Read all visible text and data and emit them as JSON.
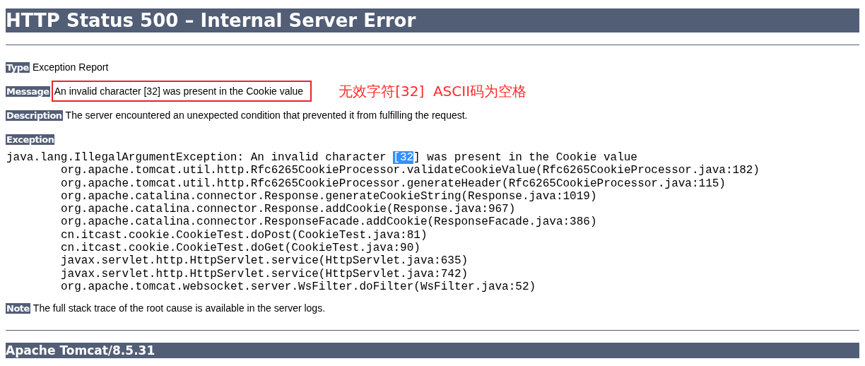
{
  "title": "HTTP Status 500 – Internal Server Error",
  "fields": [
    {
      "label": "Type",
      "value": "Exception Report",
      "boxed": false
    },
    {
      "label": "Message",
      "value": "An invalid character [32] was present in the Cookie value",
      "boxed": true,
      "annotation": "无效字符[32]  ASCII码为空格"
    },
    {
      "label": "Description",
      "value": "The server encountered an unexpected condition that prevented it from fulfilling the request.",
      "boxed": false
    }
  ],
  "exception": {
    "label": "Exception",
    "first_line": [
      {
        "text": "java.lang.IllegalArgumentException: An invalid character ",
        "selected": false
      },
      {
        "text": "[32",
        "selected": true
      },
      {
        "text": "] was present in the Cookie value",
        "selected": false
      }
    ],
    "frames": [
      "org.apache.tomcat.util.http.Rfc6265CookieProcessor.validateCookieValue(Rfc6265CookieProcessor.java:182)",
      "org.apache.tomcat.util.http.Rfc6265CookieProcessor.generateHeader(Rfc6265CookieProcessor.java:115)",
      "org.apache.catalina.connector.Response.generateCookieString(Response.java:1019)",
      "org.apache.catalina.connector.Response.addCookie(Response.java:967)",
      "org.apache.catalina.connector.ResponseFacade.addCookie(ResponseFacade.java:386)",
      "cn.itcast.cookie.CookieTest.doPost(CookieTest.java:81)",
      "cn.itcast.cookie.CookieTest.doGet(CookieTest.java:90)",
      "javax.servlet.http.HttpServlet.service(HttpServlet.java:635)",
      "javax.servlet.http.HttpServlet.service(HttpServlet.java:742)",
      "org.apache.tomcat.websocket.server.WsFilter.doFilter(WsFilter.java:52)"
    ]
  },
  "note": {
    "label": "Note",
    "value": "The full stack trace of the root cause is available in the server logs."
  },
  "footer": "Apache Tomcat/8.5.31"
}
